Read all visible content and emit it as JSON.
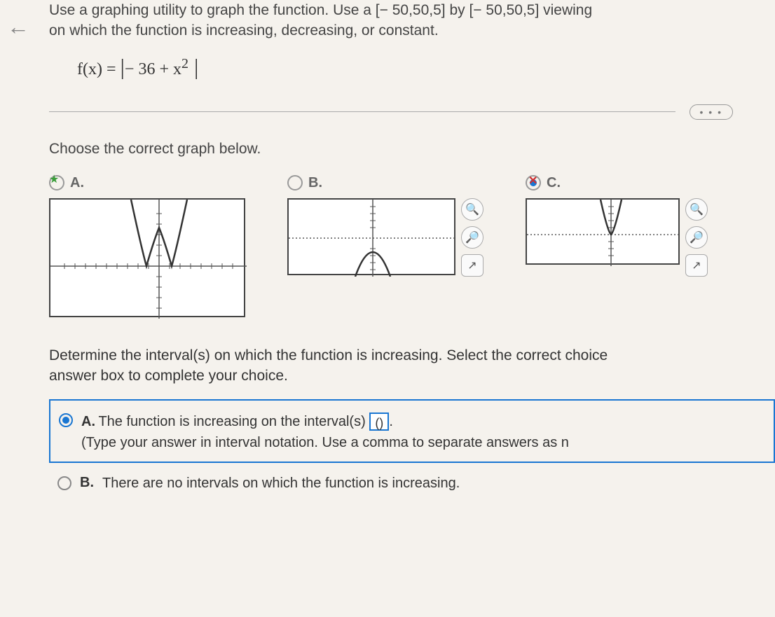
{
  "nav": {
    "back": "←"
  },
  "problem": {
    "line1": "Use a graphing utility to graph the function. Use a [− 50,50,5] by [− 50,50,5] viewing ",
    "line2": "on which the function is increasing, decreasing, or constant.",
    "equation_prefix": "f(x) = ",
    "equation_body": "− 36 + x",
    "equation_exp": "2"
  },
  "ellipsis": "• • •",
  "prompt1": "Choose the correct graph below.",
  "options": {
    "a": {
      "label": "A."
    },
    "b": {
      "label": "B."
    },
    "c": {
      "label": "C."
    }
  },
  "tools": {
    "zoom_in": "⊕",
    "zoom_out": "⊖",
    "popout": "↗"
  },
  "prompt2": {
    "line1": "Determine the interval(s) on which the function is increasing. Select the correct choice ",
    "line2": "answer box to complete your choice."
  },
  "choiceA": {
    "letter": "A.",
    "text_pre": "The function is increasing on the interval(s) ",
    "input_value": "()",
    "text_post": ".",
    "hint": "(Type your answer in interval notation. Use a comma to separate answers as n"
  },
  "choiceB": {
    "letter": "B.",
    "text": "There are no intervals on which the function is increasing."
  }
}
